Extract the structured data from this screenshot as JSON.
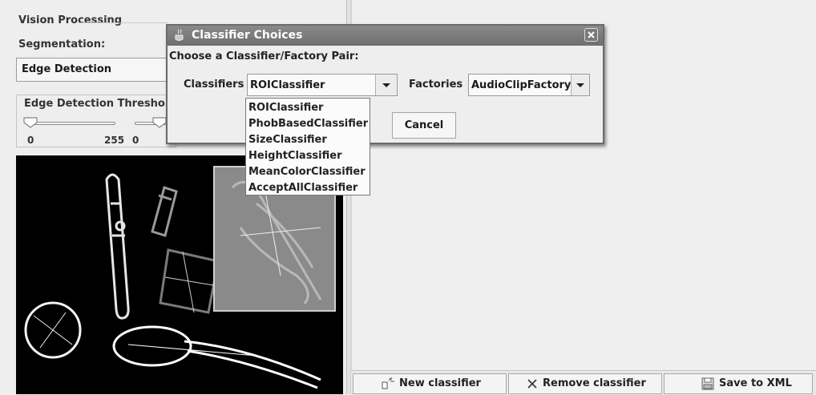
{
  "vision": {
    "section_title": "Vision Processing",
    "segmentation_label": "Segmentation:",
    "segmentation_value": "Edge Detection",
    "threshold_title": "Edge Detection Threshold",
    "slider1_min": "0",
    "slider1_max": "255",
    "slider2_min": "0"
  },
  "dialog": {
    "title": "Classifier Choices",
    "prompt": "Choose a Classifier/Factory Pair:",
    "classifiers_label": "Classifiers",
    "classifier_selected": "ROIClassifier",
    "factories_label": "Factories",
    "factory_selected": "AudioClipFactory",
    "cancel_label": "Cancel",
    "classifier_options": [
      "ROIClassifier",
      "PhobBasedClassifier",
      "SizeClassifier",
      "HeightClassifier",
      "MeanColorClassifier",
      "AcceptAllClassifier"
    ]
  },
  "toolbar": {
    "new_label": "New classifier",
    "remove_label": "Remove classifier",
    "save_label": "Save to XML"
  },
  "icons": {
    "new": "new-classifier-icon",
    "remove": "remove-x-icon",
    "save": "floppy-disk-icon",
    "dropdown": "chevron-down-icon",
    "close": "close-icon",
    "app": "java-cup-icon"
  },
  "colors": {
    "titlebar": "#6e6e6e",
    "image_background": "#000000"
  }
}
